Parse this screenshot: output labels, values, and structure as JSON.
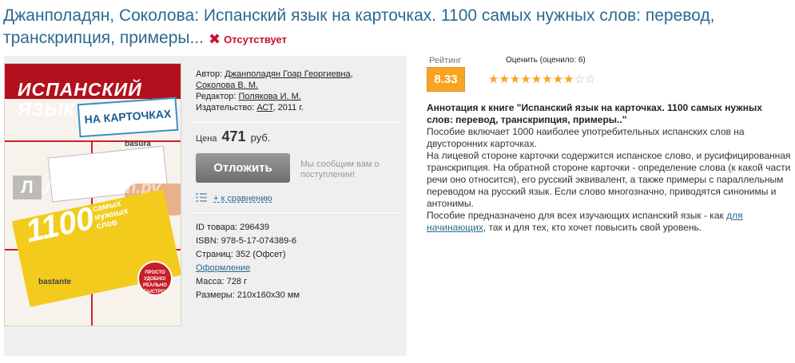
{
  "header": {
    "title": "Джанполадян, Соколова: Испанский язык на карточках. 1100 самых нужных слов: перевод, транскрипция, примеры...",
    "availability": "Отсутствует"
  },
  "cover": {
    "title_line": "ИСПАНСКИЙ ЯЗЫК",
    "subtitle": "НА КАРТОЧКАХ",
    "count": "1100",
    "count_sub": "самых нужных слов",
    "badge": "ПРОСТО УДОБНО! РЕАЛЬНО БЫСТРО!",
    "word1": "basura",
    "word2": "bastante",
    "watermark_logo": "Л",
    "watermark_text": "Лабиринт.ру"
  },
  "meta": {
    "author_label": "Автор:",
    "author1": "Джанполадян Гоар Георгиевна",
    "author2": "Соколова В. М.",
    "editor_label": "Редактор:",
    "editor": "Полякова И. М.",
    "publisher_label": "Издательство:",
    "publisher": "АСТ",
    "year": ", 2011 г."
  },
  "price": {
    "label": "Цена",
    "value": "471",
    "currency": "руб."
  },
  "actions": {
    "postpone_label": "Отложить",
    "notify_text": "Мы сообщим вам о поступлении!",
    "compare_label": "+ к сравнению"
  },
  "details": {
    "id": "ID товара: 296439",
    "isbn": "ISBN: 978-5-17-074389-6",
    "pages": "Страниц: 352 (Офсет)",
    "design": "Оформление",
    "weight": "Масса: 728 г",
    "size": "Размеры: 210x160x30 мм"
  },
  "rating": {
    "label": "Рейтинг",
    "value": "8.33",
    "rate_label": "Оценить (оценило: 6)",
    "stars_filled": 8,
    "stars_total": 10
  },
  "annotation": {
    "heading": "Аннотация к книге \"Испанский язык на карточках. 1100 самых нужных слов: перевод, транскрипция, примеры..\"",
    "p1": "Пособие включает 1000 наиболее употребительных испанских слов на двусторонних карточках.",
    "p2": "На лицевой стороне карточки содержится испанское слово, и русифицированная транскрипция. На обратной стороне карточки - определение слова (к какой части речи оно относится), его русский эквивалент, а также примеры с параллельным переводом на русский язык. Если слово многозначно, приводятся синонимы и антонимы.",
    "p3_start": "Пособие предназначено для всех изучающих испанский язык - как ",
    "p3_link": "для начинающих",
    "p3_end": ", так и для тех, кто хочет повысить свой уровень."
  },
  "colors": {
    "title": "#2b6a8f",
    "status": "#c8102e",
    "rating_bg": "#f7a420",
    "star_on": "#f4a522",
    "button": "#7d7d7d"
  }
}
